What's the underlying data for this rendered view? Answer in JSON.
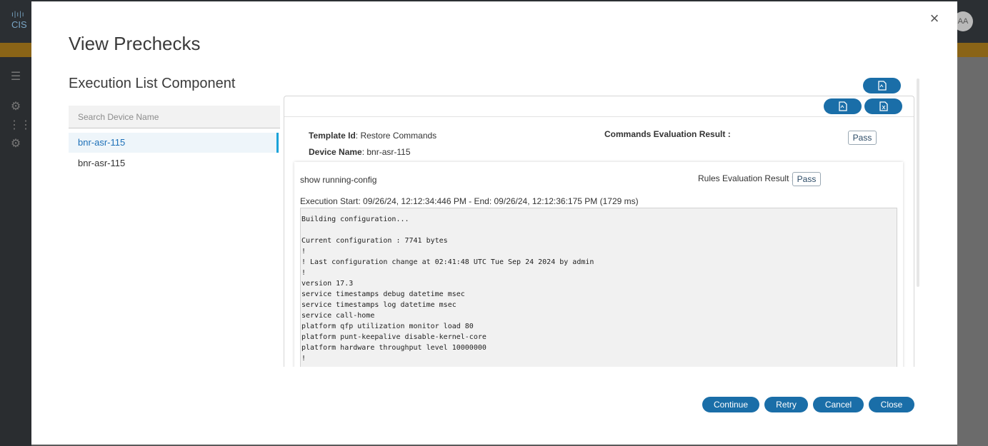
{
  "background": {
    "logo": "CIS",
    "avatar": "AA"
  },
  "modal": {
    "title": "View Prechecks",
    "section_title": "Execution List Component",
    "search": {
      "placeholder": "Search Device Name",
      "value": ""
    },
    "devices": [
      "bnr-asr-115",
      "bnr-asr-115"
    ],
    "result": {
      "template_id_label": "Template Id",
      "template_id_value": ": Restore Commands",
      "device_name_label": "Device Name",
      "device_name_value": ": bnr-asr-115",
      "commands_eval_label": "Commands Evaluation Result :",
      "commands_eval_value": "Pass",
      "command": {
        "name": "show running-config",
        "rules_eval_label": "Rules Evaluation Result :",
        "rules_eval_value": "Pass",
        "execution": "Execution Start: 09/26/24, 12:12:34:446 PM - End: 09/26/24, 12:12:36:175 PM (1729 ms)",
        "output_lines": [
          "Building configuration...",
          "",
          "Current configuration : 7741 bytes",
          "!",
          "! Last configuration change at 02:41:48 UTC Tue Sep 24 2024 by admin",
          "!",
          "version 17.3",
          "service timestamps debug datetime msec",
          "service timestamps log datetime msec",
          "service call-home",
          "platform qfp utilization monitor load 80",
          "platform punt-keepalive disable-kernel-core",
          "platform hardware throughput level 10000000",
          "!"
        ]
      }
    },
    "footer": {
      "continue": "Continue",
      "retry": "Retry",
      "cancel": "Cancel",
      "close": "Close"
    },
    "colors": {
      "accent": "#1a6ea8",
      "active_border": "#1aa3d9"
    },
    "icons": [
      "close-icon",
      "pdf-export-icon",
      "excel-export-icon"
    ]
  }
}
